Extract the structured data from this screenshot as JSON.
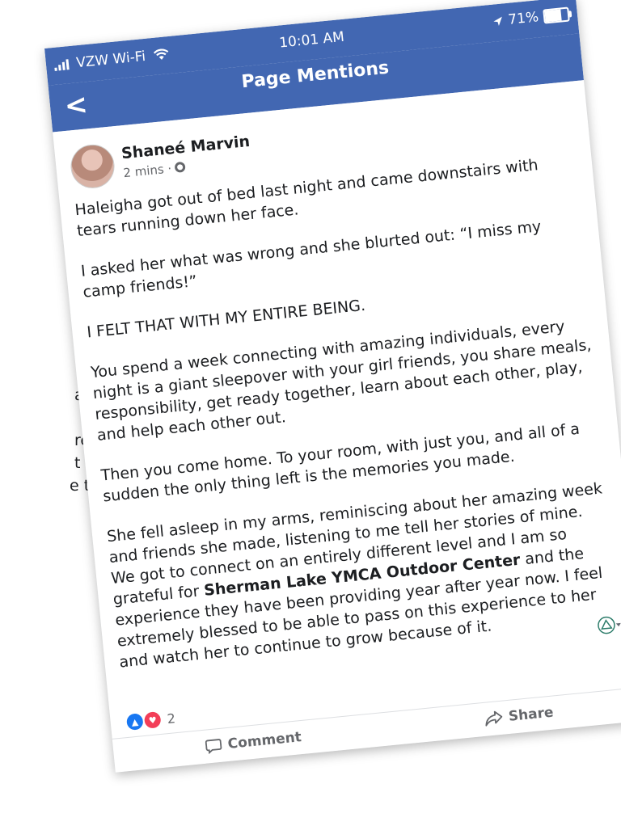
{
  "background_fragments": [
    "a",
    "re,",
    "t",
    "e that"
  ],
  "status_bar": {
    "carrier": "VZW Wi-Fi",
    "time": "10:01 AM",
    "battery": "71%",
    "battery_level": 0.71
  },
  "nav": {
    "title": "Page Mentions",
    "back_label": "<"
  },
  "post": {
    "author": "Shaneé Marvin",
    "time": "2 mins ·",
    "paragraphs": [
      "Haleigha got out of bed last night and came downstairs with tears running down her face.",
      "I asked her what was wrong and she blurted out: “I miss my camp friends!”",
      "I FELT THAT WITH MY ENTIRE BEING.",
      "You spend a week connecting with amazing individuals, every night is a giant sleepover with your girl friends, you share meals, responsibility, get ready together, learn about each other, play, and help each other out.",
      "Then you come home. To your room, with just you, and all of a sudden the only thing left is the memories you made."
    ],
    "final_paragraph": {
      "before": "She fell asleep in my arms, reminiscing about her amazing week and friends she made, listening to me tell her stories of mine. We got to connect on an entirely different level and I am so grateful for ",
      "mention": "Sherman Lake YMCA Outdoor Center",
      "after": " and the experience they have been providing year after year now. I feel extremely blessed to be able to pass on this experience to her and watch her to continue to grow because of it."
    },
    "reaction_count": "2"
  },
  "actions": {
    "comment": "Comment",
    "share": "Share"
  },
  "colors": {
    "brand": "#4267b2",
    "like": "#1877f2",
    "love": "#f33e58"
  }
}
